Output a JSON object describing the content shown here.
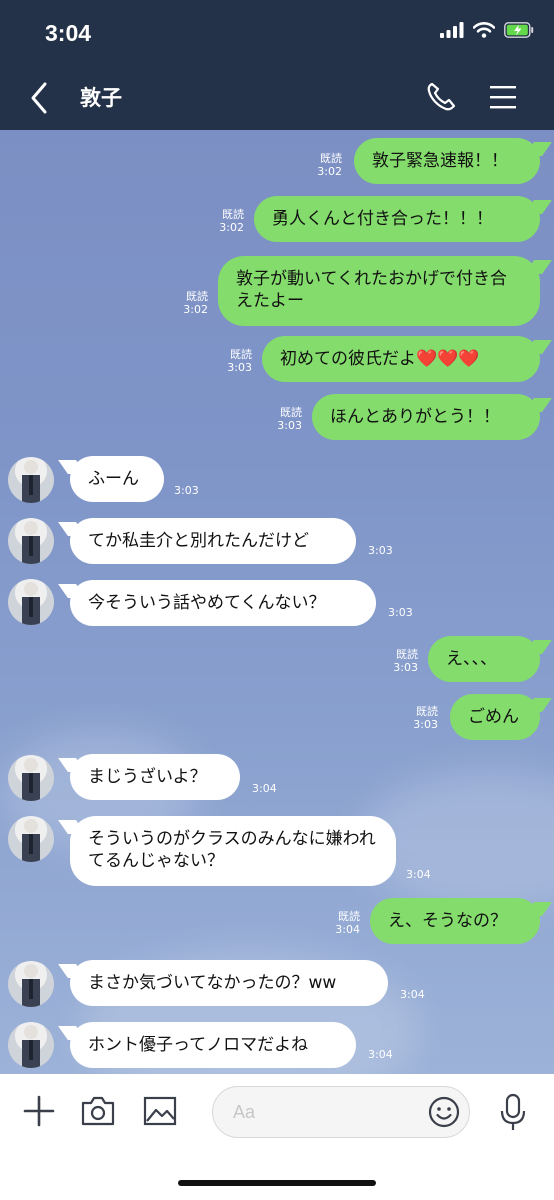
{
  "status_bar": {
    "time": "3:04"
  },
  "header": {
    "title": "敦子"
  },
  "messages": [
    {
      "dir": "out",
      "text": "敦子緊急速報！！",
      "read": "既読",
      "time": "3:02"
    },
    {
      "dir": "out",
      "text": "勇人くんと付き合った！！！",
      "read": "既読",
      "time": "3:02"
    },
    {
      "dir": "out",
      "text": "敦子が動いてくれたおかげで付き合えたよー",
      "read": "既読",
      "time": "3:02"
    },
    {
      "dir": "out",
      "text": "初めての彼氏だよ❤️❤️❤️",
      "read": "既読",
      "time": "3:03"
    },
    {
      "dir": "out",
      "text": "ほんとありがとう！！",
      "read": "既読",
      "time": "3:03"
    },
    {
      "dir": "in",
      "text": "ふーん",
      "time": "3:03"
    },
    {
      "dir": "in",
      "text": "てか私圭介と別れたんだけど",
      "time": "3:03"
    },
    {
      "dir": "in",
      "text": "今そういう話やめてくんない？",
      "time": "3:03"
    },
    {
      "dir": "out",
      "text": "え、、、",
      "read": "既読",
      "time": "3:03"
    },
    {
      "dir": "out",
      "text": "ごめん",
      "read": "既読",
      "time": "3:03"
    },
    {
      "dir": "in",
      "text": "まじうざいよ？",
      "time": "3:04"
    },
    {
      "dir": "in",
      "text": "そういうのがクラスのみんなに嫌われてるんじゃない？",
      "time": "3:04"
    },
    {
      "dir": "out",
      "text": "え、そうなの？",
      "read": "既読",
      "time": "3:04"
    },
    {
      "dir": "in",
      "text": "まさか気づいてなかったの？ww",
      "time": "3:04"
    },
    {
      "dir": "in",
      "text": "ホント優子ってノロマだよね",
      "time": "3:04"
    }
  ],
  "input": {
    "placeholder": "Aa"
  },
  "icons": {
    "back": "chevron-left-icon",
    "call": "phone-icon",
    "menu": "hamburger-icon",
    "add": "plus-icon",
    "camera": "camera-icon",
    "image": "image-icon",
    "emoji": "emoji-icon",
    "mic": "microphone-icon"
  },
  "colors": {
    "header_bg": "#243249",
    "outgoing_bubble": "#84dc6c",
    "incoming_bubble": "#ffffff",
    "chat_bg": "#7f95c8"
  }
}
